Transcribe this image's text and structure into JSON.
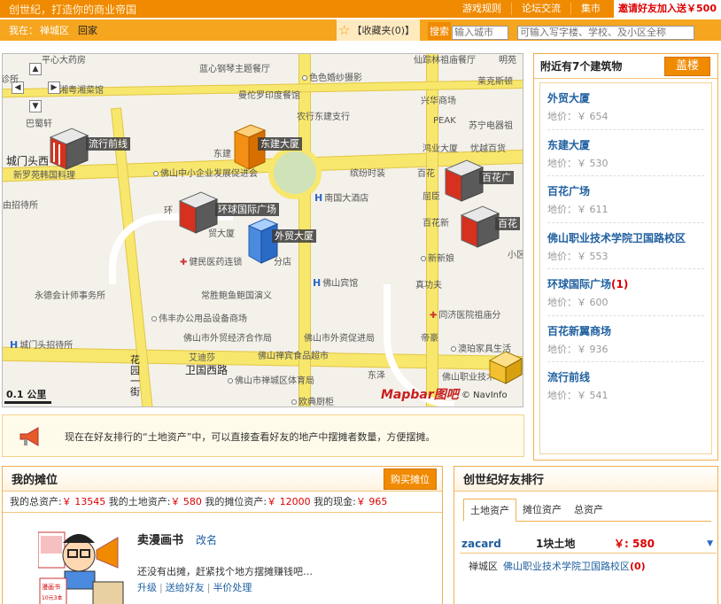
{
  "topbar": {
    "slogan": "创世纪，打造你的商业帝国",
    "nav": [
      "游戏规则",
      "论坛交流",
      "集市"
    ],
    "invite": "邀请好友加入送￥500"
  },
  "subbar": {
    "location_label": "我在：",
    "location_value": "禅城区",
    "home_link": "回家",
    "favorites": "【收藏夹(0)】",
    "search_label": "搜索",
    "city_placeholder": "输入城市",
    "place_placeholder": "可输入写字楼、学校、及小区全称"
  },
  "map": {
    "scale": "0.1 公里",
    "logo": "Mapbar图吧",
    "credit": "© NavInfo",
    "buildings": [
      "流行前线",
      "东建大厦",
      "环球国际广场",
      "外贸大厦",
      "百花广",
      "百花"
    ],
    "places": [
      "平心大药房",
      "诊所",
      "湘粤湘菜馆",
      "巴蜀轩",
      "城门头西",
      "新罗苑韩国料理",
      "由招待所",
      "蓝心钢琴主题餐厅",
      "色色婚纱摄影",
      "曼佗罗印度餐馆",
      "农行东建支行",
      "东建",
      "佛山中小企业发展促进会",
      "缤纷时装",
      "南国大酒店",
      "百花",
      "屈臣",
      "百花新",
      "新新娘",
      "健民医药连锁",
      "分店",
      "贸大厦",
      "环",
      "常胜鲍鱼鲍国演义",
      "佛山宾馆",
      "真功夫",
      "同济医院祖庙分",
      "伟丰办公用品设备商场",
      "佛山市外贸经济合作局",
      "佛山市外资促进局",
      "帝豪",
      "澳珀家具生活",
      "艾迪莎",
      "佛山禅宾食品超市",
      "佛山市禅城区体育局",
      "东泽",
      "佛山职业技术",
      "卫国西路",
      "花园一街",
      "欧典厨柜",
      "永德会计师事务所",
      "城门头招待所",
      "仙踪林祖庙餐厅",
      "明苑",
      "苏宁电器祖",
      "莱克斯顿",
      "兴华商场",
      "PEAK",
      "鸿业大厦",
      "忧越百货",
      "小区"
    ]
  },
  "nearby": {
    "title": "附近有7个建筑物",
    "build_button": "盖楼",
    "items": [
      {
        "name": "外贸大厦",
        "count": "",
        "price": "地价：￥ 654"
      },
      {
        "name": "东建大厦",
        "count": "",
        "price": "地价：￥ 530"
      },
      {
        "name": "百花广场",
        "count": "",
        "price": "地价：￥ 611"
      },
      {
        "name": "佛山职业技术学院卫国路校区",
        "count": "",
        "price": "地价：￥ 553"
      },
      {
        "name": "环球国际广场",
        "count": "(1)",
        "price": "地价：￥ 600"
      },
      {
        "name": "百花新翼商场",
        "count": "",
        "price": "地价：￥ 936"
      },
      {
        "name": "流行前线",
        "count": "",
        "price": "地价：￥ 541"
      }
    ]
  },
  "notice": {
    "text": "现在在好友排行的“土地资产”中，可以直接查看好友的地产中摆摊者数量，方便摆摊。"
  },
  "stall": {
    "title": "我的摊位",
    "buy_button": "购买摊位",
    "total_label": "我的总资产:",
    "total_value": "￥ 13545",
    "land_label": " 我的土地资产:",
    "land_value": "￥ 580",
    "booth_label": " 我的摊位资产:",
    "booth_value": "￥ 12000",
    "cash_label": " 我的现金:",
    "cash_value": "￥ 965",
    "name": "卖漫画书",
    "rename": "改名",
    "comic_sign_1": "漫画书",
    "comic_sign_2": "10元3本",
    "empty_text": "还没有出摊，赶紧找个地方摆摊赚钱吧…",
    "links": [
      "升级",
      "送给好友",
      "半价处理"
    ]
  },
  "ranking": {
    "title": "创世纪好友排行",
    "tabs": [
      "土地资产",
      "摊位资产",
      "总资产"
    ],
    "row": {
      "user": "zacard",
      "land": "1块土地",
      "value": "￥: 580"
    },
    "sub_area": "禅城区",
    "sub_building": "佛山职业技术学院卫国路校区",
    "sub_count": "(0)"
  }
}
